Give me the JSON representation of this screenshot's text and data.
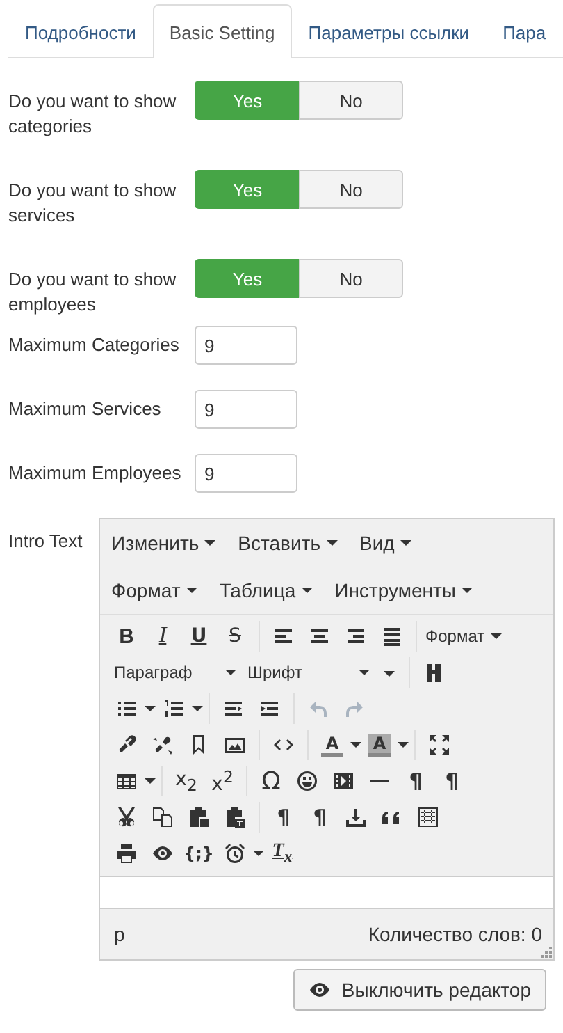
{
  "tabs": [
    {
      "label": "Подробности",
      "selected": false
    },
    {
      "label": "Basic Setting",
      "selected": true
    },
    {
      "label": "Параметры ссылки",
      "selected": false
    },
    {
      "label": "Пара",
      "selected": false
    }
  ],
  "toggles": [
    {
      "label": "Do you want to show categories",
      "options": [
        {
          "label": "Yes",
          "selected": true
        },
        {
          "label": "No",
          "selected": false
        }
      ]
    },
    {
      "label": "Do you want to show services",
      "options": [
        {
          "label": "Yes",
          "selected": true
        },
        {
          "label": "No",
          "selected": false
        }
      ]
    },
    {
      "label": "Do you want to show employees",
      "options": [
        {
          "label": "Yes",
          "selected": true
        },
        {
          "label": "No",
          "selected": false
        }
      ]
    }
  ],
  "fields": [
    {
      "label": "Maximum Categories",
      "value": "9"
    },
    {
      "label": "Maximum Services",
      "value": "9"
    },
    {
      "label": "Maximum Employees",
      "value": "9"
    }
  ],
  "editor": {
    "label": "Intro Text",
    "menus": [
      [
        "Изменить",
        "Вставить",
        "Вид"
      ],
      [
        "Формат",
        "Таблица",
        "Инструменты"
      ]
    ],
    "dropdowns": [
      "Формат",
      "Параграф",
      "Шрифт"
    ],
    "glyphs": [
      "B",
      "I",
      "U",
      "S",
      "A",
      "A",
      "x$_{2}$",
      "x$^{2}$",
      "Ω",
      "¶",
      "¶",
      "¶",
      "¶",
      "{;}",
      "T$_{x}$"
    ],
    "history": [
      {
        "disabled": true
      },
      {
        "disabled": true
      }
    ],
    "path": "p",
    "word_count": "Количество слов: 0"
  },
  "toggle_button": "Выключить редактор"
}
